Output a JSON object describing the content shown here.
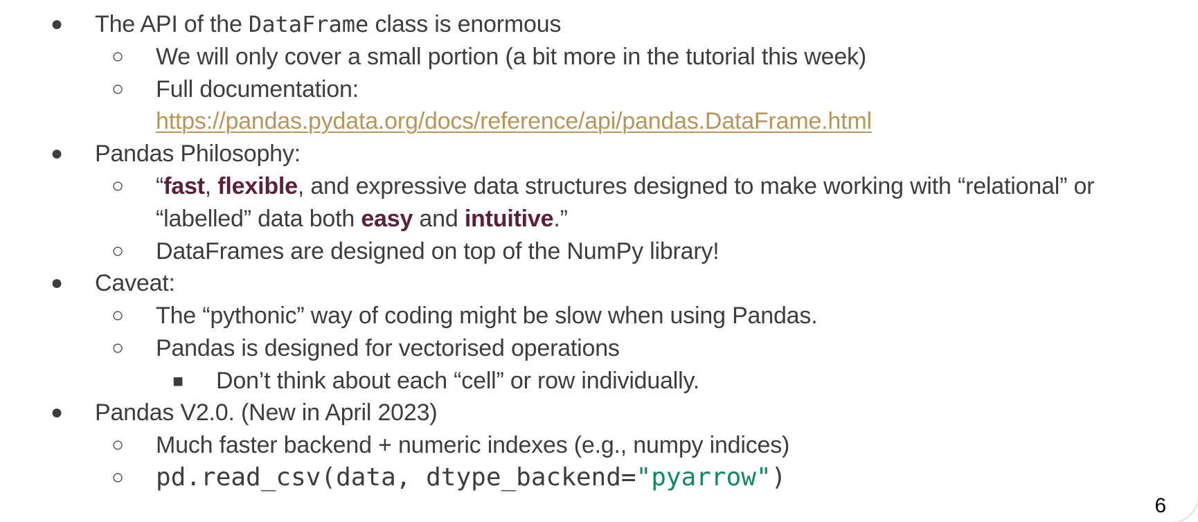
{
  "slide": {
    "page_number": "6",
    "bullet_level1": "●",
    "bullet_level2": "○",
    "bullet_level3": "■",
    "items": {
      "api": {
        "prefix": "The API of the ",
        "code": "DataFrame",
        "suffix": " class is enormous"
      },
      "api_sub1": "We will only cover a small portion (a bit more in the tutorial this week)",
      "api_sub2_label": "Full documentation:",
      "api_sub2_link": "https://pandas.pydata.org/docs/reference/api/pandas.DataFrame.html",
      "philosophy": "Pandas Philosophy:",
      "philosophy_quote": {
        "open": "“",
        "fast": "fast",
        "comma": ", ",
        "flexible": "flexible",
        "rest_line1": ", and expressive data structures designed to make working with “relational” or",
        "line2_prefix": "“labelled” data both ",
        "easy": "easy",
        "and": " and ",
        "intuitive": "intuitive",
        "close": ".”"
      },
      "philosophy_sub2": "DataFrames are designed on top of the NumPy library!",
      "caveat": "Caveat:",
      "caveat_sub1": "The “pythonic” way of coding might be slow when using Pandas.",
      "caveat_sub2": "Pandas is designed for vectorised operations",
      "caveat_sub2_sub1": "Don’t think about each “cell” or row individually.",
      "v2": "Pandas V2.0. (New in April 2023)",
      "v2_sub1": "Much faster backend + numeric indexes (e.g., numpy indices)",
      "v2_code": {
        "prefix": "pd.read_csv(data, dtype_backend=",
        "string": "\"pyarrow\"",
        "suffix": ")"
      }
    }
  }
}
